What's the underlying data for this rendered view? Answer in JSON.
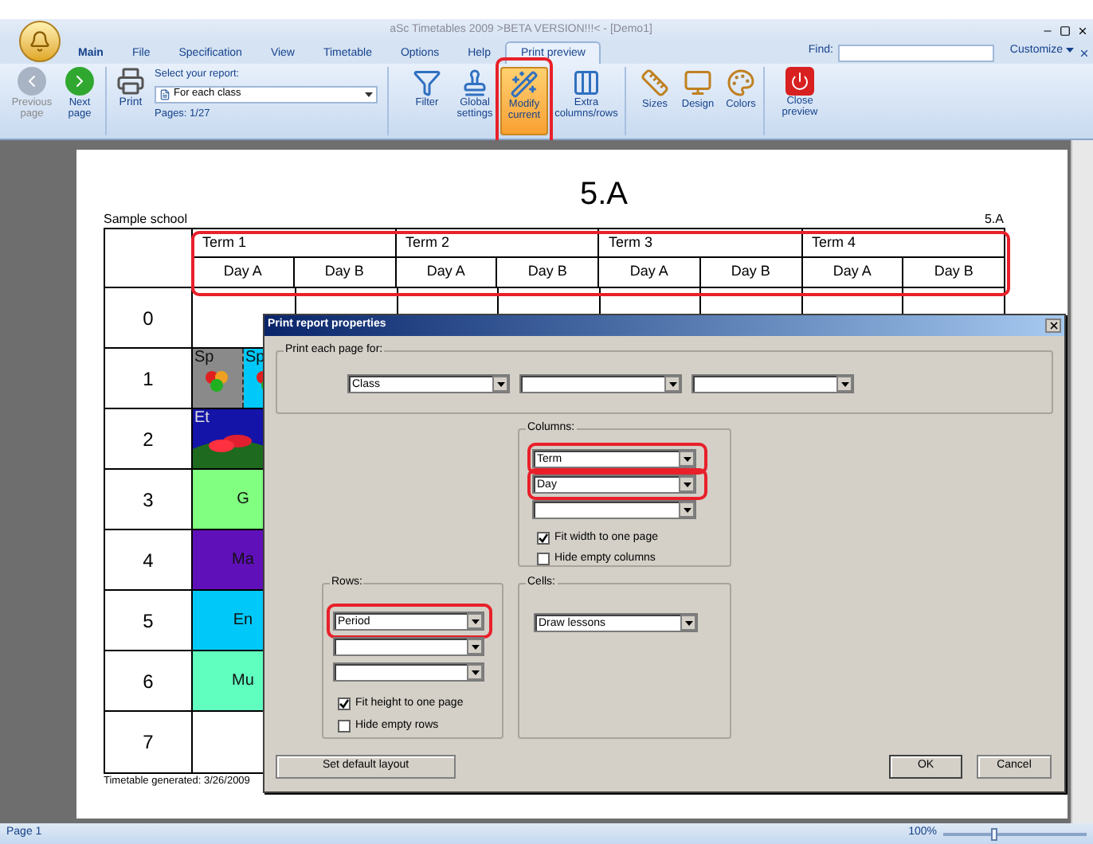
{
  "window": {
    "title": "aSc Timetables 2009   >BETA VERSION!!!< - [Demo1]"
  },
  "menu_tabs": [
    {
      "label": "Main",
      "selected": false
    },
    {
      "label": "File",
      "selected": false
    },
    {
      "label": "Specification",
      "selected": false
    },
    {
      "label": "View",
      "selected": false
    },
    {
      "label": "Timetable",
      "selected": false
    },
    {
      "label": "Options",
      "selected": false
    },
    {
      "label": "Help",
      "selected": false
    },
    {
      "label": "Print preview",
      "selected": true
    }
  ],
  "find": {
    "label": "Find:"
  },
  "customize": "Customize",
  "ribbon": {
    "nav": [
      {
        "label": "Previous page",
        "disabled": true
      },
      {
        "label": "Next page",
        "disabled": false
      }
    ],
    "print": "Print",
    "report_label": "Select your report:",
    "report_value": "For each class",
    "pages": "Pages: 1/27",
    "tools": [
      {
        "label": "Filter",
        "kind": "filter",
        "selected": false
      },
      {
        "label": "Global settings",
        "kind": "stamp",
        "selected": false
      },
      {
        "label": "Modify current",
        "kind": "wand",
        "selected": true
      },
      {
        "label": "Extra columns/rows",
        "kind": "columns",
        "selected": false
      }
    ],
    "format": [
      {
        "label": "Sizes",
        "kind": "ruler"
      },
      {
        "label": "Design",
        "kind": "monitor"
      },
      {
        "label": "Colors",
        "kind": "palette"
      }
    ],
    "close": "Close preview"
  },
  "page": {
    "title": "5.A",
    "school": "Sample school",
    "class_tag": "5.A",
    "terms": [
      "Term 1",
      "Term 2",
      "Term 3",
      "Term 4"
    ],
    "days": [
      "Day A",
      "Day B",
      "Day A",
      "Day B",
      "Day A",
      "Day B",
      "Day A",
      "Day B"
    ],
    "periods": [
      {
        "number": "0"
      },
      {
        "number": "1",
        "lessons": [
          {
            "text": "Sp",
            "color": "#8a8a8a",
            "kind": "picture"
          },
          {
            "text": "Sp",
            "color": "#00c8f8",
            "kind": "picture"
          }
        ]
      },
      {
        "number": "2",
        "lessons": [
          {
            "text": "Et",
            "color": "#1414a8",
            "kind": "landscape"
          }
        ]
      },
      {
        "number": "3",
        "lessons": [
          {
            "text": "G",
            "color": "#80ff80",
            "kind": "plain"
          }
        ]
      },
      {
        "number": "4",
        "lessons": [
          {
            "text": "Ma",
            "color": "#6010b8",
            "kind": "plain"
          }
        ]
      },
      {
        "number": "5",
        "lessons": [
          {
            "text": "En",
            "color": "#00c8f8",
            "kind": "plain"
          }
        ]
      },
      {
        "number": "6",
        "lessons": [
          {
            "text": "Mu",
            "color": "#60ffc0",
            "kind": "plain"
          }
        ]
      },
      {
        "number": "7"
      }
    ],
    "footer": "Timetable generated: 3/26/2009"
  },
  "dialog": {
    "title": "Print report properties",
    "print_each": {
      "label": "Print each page for:",
      "values": [
        {
          "kind": "filled",
          "value": "Class"
        },
        {
          "kind": "blank"
        },
        {
          "kind": "blank"
        }
      ]
    },
    "columns": {
      "label": "Columns:",
      "values": [
        {
          "kind": "filled",
          "value": "Term"
        },
        {
          "kind": "filled",
          "value": "Day"
        },
        {
          "kind": "blank"
        }
      ],
      "checks": [
        {
          "label": "Fit width to one page",
          "checked": true
        },
        {
          "label": "Hide empty columns",
          "checked": false
        }
      ]
    },
    "rows": {
      "label": "Rows:",
      "values": [
        {
          "kind": "filled",
          "value": "Period"
        },
        {
          "kind": "blank"
        },
        {
          "kind": "blank"
        }
      ],
      "checks": [
        {
          "label": "Fit height to one page",
          "checked": true
        },
        {
          "label": "Hide empty rows",
          "checked": false
        }
      ]
    },
    "cells": {
      "label": "Cells:",
      "value": "Draw lessons"
    },
    "buttons": [
      "Set default layout",
      "OK",
      "Cancel"
    ]
  },
  "status_bar": {
    "page": "Page 1",
    "zoom": "100%",
    "zoom_slider": {
      "level": 0.35
    }
  }
}
